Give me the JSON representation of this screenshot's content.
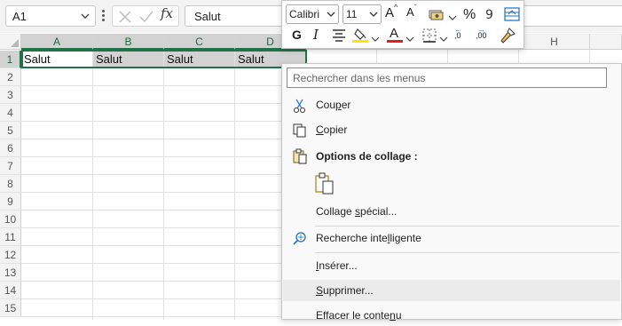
{
  "formula_bar": {
    "name_box": "A1",
    "formula": "Salut",
    "fx_label": "fx"
  },
  "columns": [
    "A",
    "B",
    "C",
    "D",
    "H"
  ],
  "rows": [
    "1",
    "2",
    "3",
    "4",
    "5",
    "6",
    "7",
    "8",
    "9",
    "10",
    "11",
    "12",
    "13",
    "14",
    "15"
  ],
  "cells": {
    "A1": "Salut",
    "B1": "Salut",
    "C1": "Salut",
    "D1": "Salut"
  },
  "mini_toolbar": {
    "font": "Calibri",
    "size": "11",
    "bold": "G",
    "font_color": "A",
    "increase_font": "A",
    "decrease_font": "A",
    "percent": "%",
    "dec_more": ",0",
    "dec_less": ",00",
    "colors": {
      "highlight": "#ffe600",
      "font": "#e01e1e"
    }
  },
  "context_menu": {
    "search_placeholder": "Rechercher dans les menus",
    "cut": [
      "Cou",
      "p",
      "er"
    ],
    "copy": [
      "",
      "C",
      "opier"
    ],
    "paste_options": "Options de collage :",
    "paste_special": [
      "Collage ",
      "s",
      "pécial..."
    ],
    "smart_lookup": [
      "Recherche inte",
      "l",
      "ligente"
    ],
    "insert": [
      "",
      "I",
      "nsérer..."
    ],
    "delete": [
      "",
      "S",
      "upprimer..."
    ],
    "clear": [
      "Effacer le conte",
      "n",
      "u"
    ]
  },
  "colors": {
    "accent": "#217346",
    "selection_fill": "#d2d2d2"
  }
}
